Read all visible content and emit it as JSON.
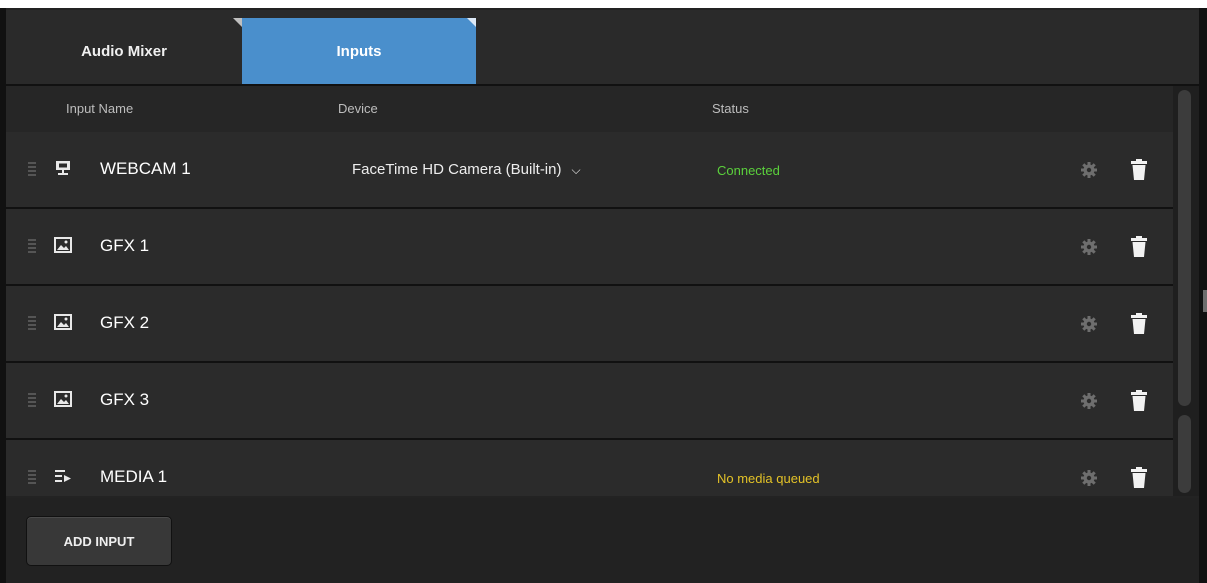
{
  "tabs": [
    {
      "label": "Audio Mixer",
      "active": false
    },
    {
      "label": "Inputs",
      "active": true
    }
  ],
  "columns": {
    "name": "Input Name",
    "device": "Device",
    "status": "Status"
  },
  "rows": [
    {
      "name": "WEBCAM 1",
      "type_icon": "webcam-icon",
      "device": "FaceTime HD Camera (Built-in)",
      "status": "Connected",
      "status_color": "#5bd13c"
    },
    {
      "name": "GFX 1",
      "type_icon": "image-icon",
      "device": "",
      "status": "",
      "status_color": ""
    },
    {
      "name": "GFX 2",
      "type_icon": "image-icon",
      "device": "",
      "status": "",
      "status_color": ""
    },
    {
      "name": "GFX 3",
      "type_icon": "image-icon",
      "device": "",
      "status": "",
      "status_color": ""
    },
    {
      "name": "MEDIA 1",
      "type_icon": "media-playlist-icon",
      "device": "",
      "status": "No media queued",
      "status_color": "#e3c227"
    }
  ],
  "footer": {
    "add_input_label": "ADD INPUT"
  },
  "colors": {
    "accent": "#4a8fcc",
    "background": "#232323",
    "row": "#2b2b2b"
  }
}
